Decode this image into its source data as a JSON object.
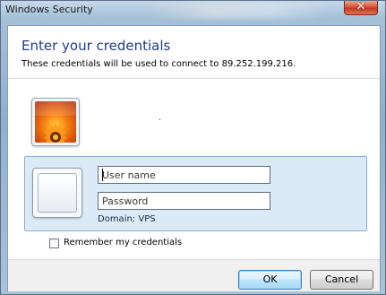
{
  "window": {
    "title": "Windows Security",
    "close_glyph": "✕"
  },
  "dialog": {
    "heading": "Enter your credentials",
    "subheading": "These credentials will be used to connect to 89.252.199.216."
  },
  "credentials": {
    "username_placeholder": "User name",
    "password_placeholder": "Password",
    "domain_text": "Domain: VPS"
  },
  "options": {
    "remember_label": "Remember my credentials",
    "remember_checked": false
  },
  "buttons": {
    "ok_label": "OK",
    "cancel_label": "Cancel"
  },
  "icons": {
    "user_tile": "flower-user-picture-icon",
    "blank_tile": "blank-user-tile-icon",
    "close": "close-icon"
  },
  "colors": {
    "heading": "#1f3b88",
    "panel": "#dceaf7",
    "close_button": "#c23a1e"
  }
}
